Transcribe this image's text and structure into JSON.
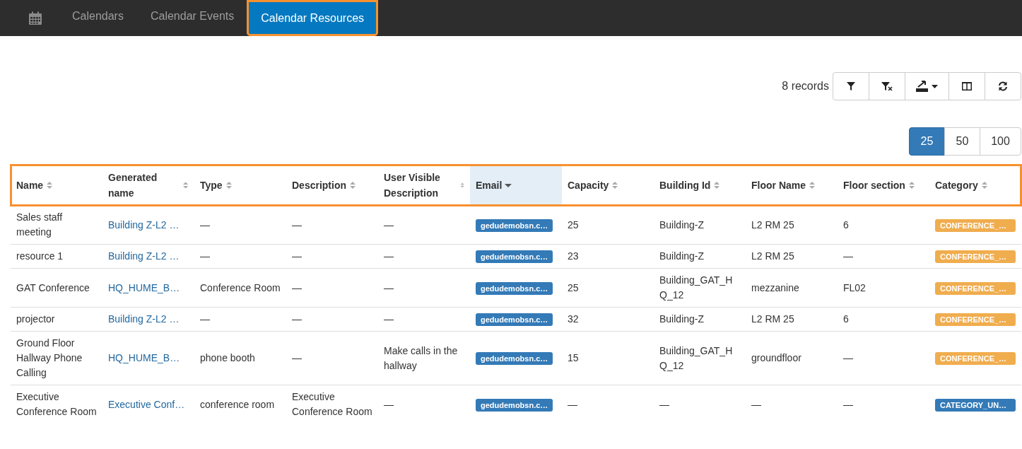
{
  "nav": {
    "tabs": [
      {
        "label": "Calendars",
        "selected": false
      },
      {
        "label": "Calendar Events",
        "selected": false
      },
      {
        "label": "Calendar Resources",
        "selected": true
      }
    ]
  },
  "toolbar": {
    "record_count": "8 records"
  },
  "page_sizes": [
    {
      "label": "25",
      "selected": true
    },
    {
      "label": "50",
      "selected": false
    },
    {
      "label": "100",
      "selected": false
    }
  ],
  "table": {
    "columns": [
      {
        "label": "Name",
        "sorted": false
      },
      {
        "label": "Generated name",
        "sorted": false
      },
      {
        "label": "Type",
        "sorted": false
      },
      {
        "label": "Description",
        "sorted": false
      },
      {
        "label": "User Visible Description",
        "sorted": false
      },
      {
        "label": "Email",
        "sorted": true
      },
      {
        "label": "Capacity",
        "sorted": false
      },
      {
        "label": "Building Id",
        "sorted": false
      },
      {
        "label": "Floor Name",
        "sorted": false
      },
      {
        "label": "Floor section",
        "sorted": false
      },
      {
        "label": "Category",
        "sorted": false
      }
    ],
    "rows": [
      {
        "name": "Sales staff meeting",
        "generated_name": "Building Z-L2 …",
        "type": "—",
        "description": "—",
        "user_visible_description": "—",
        "email": "gedudemobsn.c…",
        "capacity": "25",
        "building_id": "Building-Z",
        "floor_name": "L2 RM 25",
        "floor_section": "6",
        "category": {
          "label": "CONFERENCE_…",
          "color": "#f0ad4e"
        }
      },
      {
        "name": "resource 1",
        "generated_name": "Building Z-L2 …",
        "type": "—",
        "description": "—",
        "user_visible_description": "—",
        "email": "gedudemobsn.c…",
        "capacity": "23",
        "building_id": "Building-Z",
        "floor_name": "L2 RM 25",
        "floor_section": "—",
        "category": {
          "label": "CONFERENCE_…",
          "color": "#f0ad4e"
        }
      },
      {
        "name": "GAT Conference",
        "generated_name": "HQ_HUME_B…",
        "type": "Conference Room",
        "description": "—",
        "user_visible_description": "—",
        "email": "gedudemobsn.c…",
        "capacity": "25",
        "building_id": "Building_GAT_HQ_12",
        "floor_name": "mezzanine",
        "floor_section": "FL02",
        "category": {
          "label": "CONFERENCE_…",
          "color": "#f0ad4e"
        }
      },
      {
        "name": "projector",
        "generated_name": "Building Z-L2 …",
        "type": "—",
        "description": "—",
        "user_visible_description": "—",
        "email": "gedudemobsn.c…",
        "capacity": "32",
        "building_id": "Building-Z",
        "floor_name": "L2 RM 25",
        "floor_section": "6",
        "category": {
          "label": "CONFERENCE_…",
          "color": "#f0ad4e"
        }
      },
      {
        "name": "Ground Floor Hallway Phone Calling",
        "generated_name": "HQ_HUME_B…",
        "type": "phone booth",
        "description": "—",
        "user_visible_description": "Make calls in the hallway",
        "email": "gedudemobsn.c…",
        "capacity": "15",
        "building_id": "Building_GAT_HQ_12",
        "floor_name": "groundfloor",
        "floor_section": "—",
        "category": {
          "label": "CONFERENCE_…",
          "color": "#f0ad4e"
        }
      },
      {
        "name": "Executive Conference Room",
        "generated_name": "Executive Conf…",
        "type": "conference room",
        "description": "Executive Conference Room",
        "user_visible_description": "—",
        "email": "gedudemobsn.c…",
        "capacity": "—",
        "building_id": "—",
        "floor_name": "—",
        "floor_section": "—",
        "category": {
          "label": "CATEGORY_UN…",
          "color": "#337ab7"
        }
      }
    ]
  }
}
